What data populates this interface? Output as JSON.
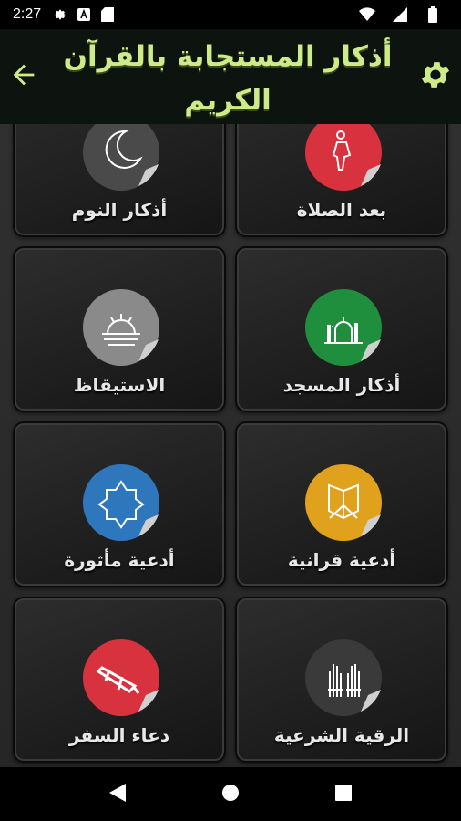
{
  "status_bar": {
    "time": "2:27",
    "icons": [
      "gear-icon",
      "a-icon",
      "sd-card-icon",
      "wifi-icon",
      "signal-icon",
      "battery-icon"
    ]
  },
  "app_bar": {
    "title": "أذكار المستجابة بالقرآن الكريم",
    "title_color": "#cdeb88",
    "back_icon": "arrow-left-icon",
    "settings_icon": "gear-icon"
  },
  "cards": [
    {
      "label": "بعد الصلاة",
      "icon": "praying-person-icon",
      "color": "#d9323f"
    },
    {
      "label": "أذكار النوم",
      "icon": "crescent-moon-icon",
      "color": "#4a4a4a"
    },
    {
      "label": "أذكار المسجد",
      "icon": "mosque-icon",
      "color": "#1f8f3e"
    },
    {
      "label": "الاستيقاظ",
      "icon": "sunrise-icon",
      "color": "#8a8a8a"
    },
    {
      "label": "أدعية قرانية",
      "icon": "quran-book-icon",
      "color": "#e0a21c"
    },
    {
      "label": "أدعية مأثورة",
      "icon": "islamic-star-icon",
      "color": "#2f77bd"
    },
    {
      "label": "الرقية الشرعية",
      "icon": "raised-hands-icon",
      "color": "#3a3a3a"
    },
    {
      "label": "دعاء السفر",
      "icon": "airplane-icon",
      "color": "#d9323f"
    }
  ],
  "nav_bar": {
    "back": "triangle-back-icon",
    "home": "circle-home-icon",
    "recents": "square-recents-icon"
  }
}
